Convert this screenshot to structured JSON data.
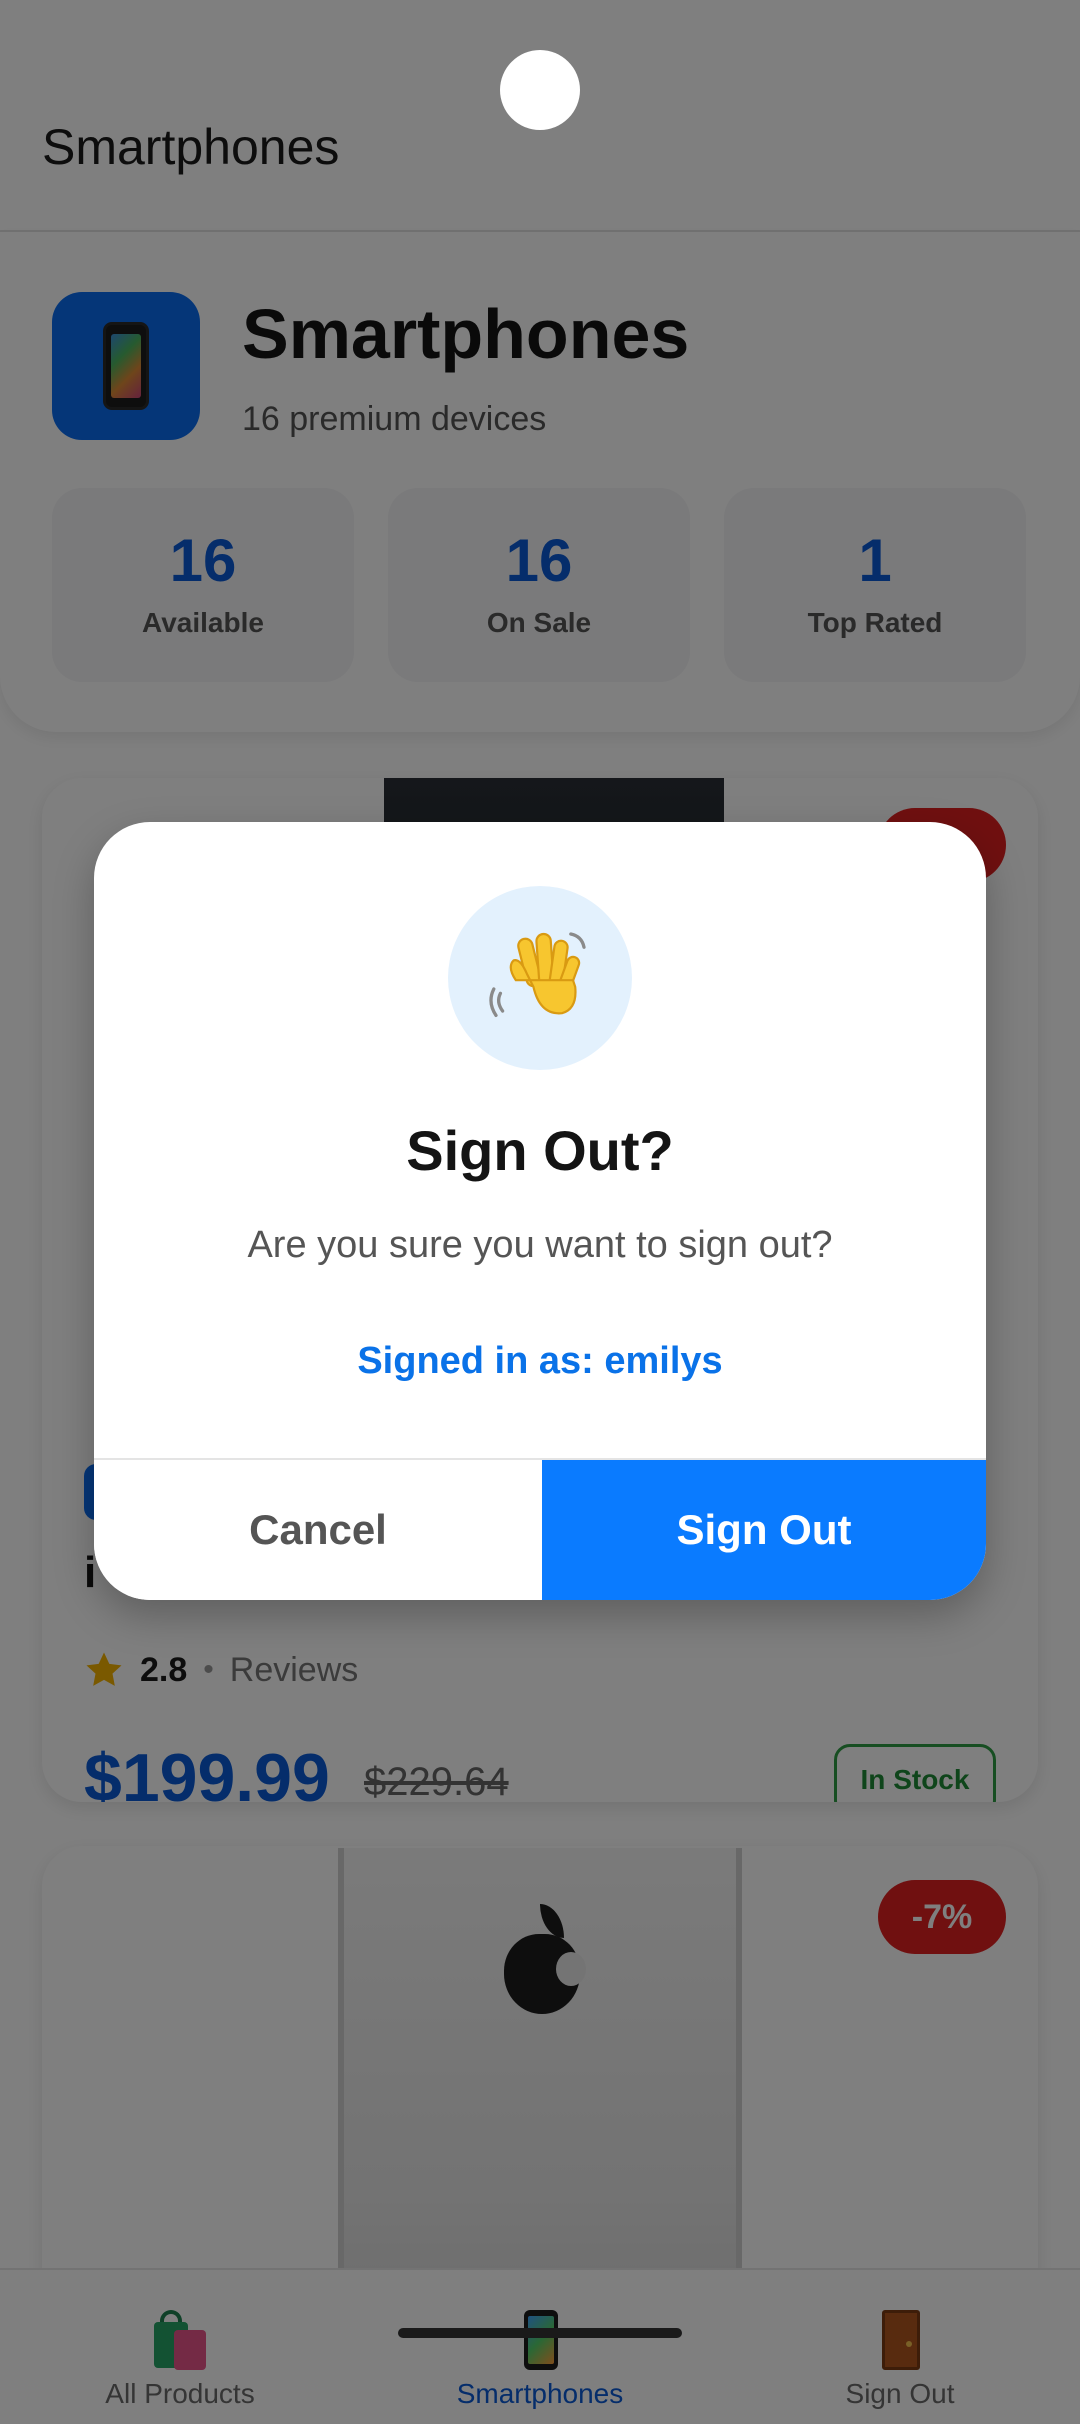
{
  "appbar": {
    "title": "Smartphones"
  },
  "category": {
    "title": "Smartphones",
    "subtitle": "16 premium devices",
    "icon": "smartphone-icon",
    "stats": [
      {
        "value": "16",
        "label": "Available"
      },
      {
        "value": "16",
        "label": "On Sale"
      },
      {
        "value": "1",
        "label": "Top Rated"
      }
    ]
  },
  "products": [
    {
      "name": "i",
      "rating": "2.8",
      "separator": "•",
      "reviews_label": "Reviews",
      "price": "$199.99",
      "old_price": "$229.64",
      "stock": "In Stock"
    },
    {
      "discount": "-7%"
    }
  ],
  "dialog": {
    "icon": "waving-hand-icon",
    "title": "Sign Out?",
    "message": "Are you sure you want to sign out?",
    "user_line": "Signed in as: emilys",
    "cancel_label": "Cancel",
    "confirm_label": "Sign Out"
  },
  "bottom_nav": {
    "items": [
      {
        "label": "All Products",
        "icon": "shopping-bags-icon",
        "active": false
      },
      {
        "label": "Smartphones",
        "icon": "smartphone-icon",
        "active": true
      },
      {
        "label": "Sign Out",
        "icon": "door-icon",
        "active": false
      }
    ]
  },
  "colors": {
    "primary": "#0a7bff",
    "accent_text": "#0a5ad6",
    "discount": "#e02020",
    "in_stock": "#2e9d45"
  }
}
